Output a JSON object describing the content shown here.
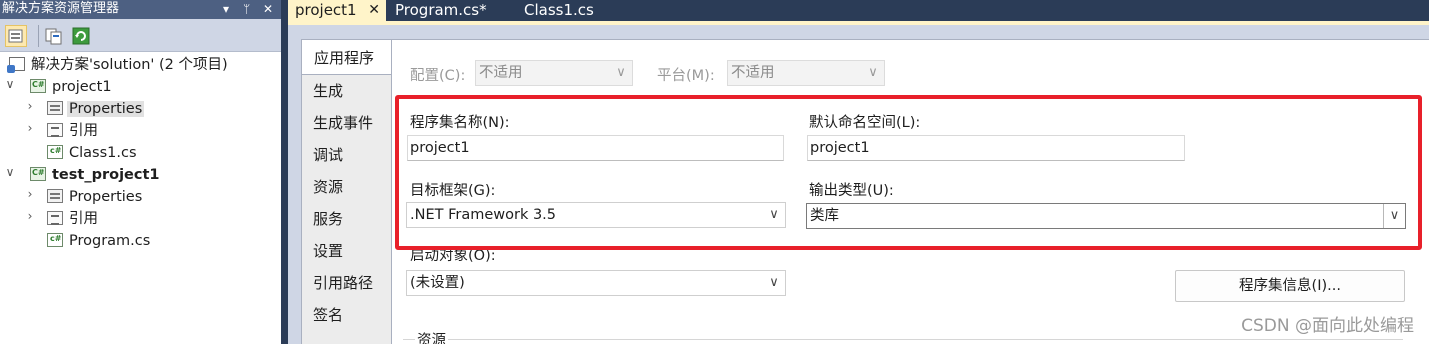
{
  "solution_explorer": {
    "title": "解决方案资源管理器",
    "pin_glyph": "▾",
    "autohide_glyph": "ᛘ",
    "close_glyph": "✕",
    "tree": [
      {
        "label": "解决方案'solution' (2 个项目)",
        "icon": "solution-icon"
      },
      {
        "label": "project1",
        "icon": "csharp-project-icon",
        "expander": "∨"
      },
      {
        "label": "Properties",
        "icon": "properties-icon",
        "expander": "›"
      },
      {
        "label": "引用",
        "icon": "references-icon",
        "expander": "›"
      },
      {
        "label": "Class1.cs",
        "icon": "csharp-file-icon"
      },
      {
        "label": "test_project1",
        "icon": "csharp-project-icon",
        "expander": "∨"
      },
      {
        "label": "Properties",
        "icon": "properties-icon",
        "expander": "›"
      },
      {
        "label": "引用",
        "icon": "references-icon",
        "expander": "›"
      },
      {
        "label": "Program.cs",
        "icon": "csharp-file-icon"
      }
    ]
  },
  "doc_tabs": [
    {
      "label": "project1",
      "close": "✕"
    },
    {
      "label": "Program.cs*"
    },
    {
      "label": "Class1.cs"
    }
  ],
  "sidebar": {
    "items": [
      "应用程序",
      "生成",
      "生成事件",
      "调试",
      "资源",
      "服务",
      "设置",
      "引用路径",
      "签名"
    ]
  },
  "form": {
    "config_label": "配置(C):",
    "config_value": "不适用",
    "platform_label": "平台(M):",
    "platform_value": "不适用",
    "assembly_name_label": "程序集名称(N):",
    "assembly_name_value": "project1",
    "default_namespace_label": "默认命名空间(L):",
    "default_namespace_value": "project1",
    "target_framework_label": "目标框架(G):",
    "target_framework_value": ".NET Framework 3.5",
    "output_type_label": "输出类型(U):",
    "output_type_value": "类库",
    "startup_object_label": "启动对象(O):",
    "startup_object_value": "(未设置)",
    "assembly_info_button": "程序集信息(I)...",
    "resources_group_label": "资源",
    "chevron": "∨"
  },
  "colors": {
    "highlight_box": "#e8202a",
    "active_tab": "#fff4c9",
    "title_bar": "#4d6082"
  },
  "watermark": "CSDN @面向此处编程"
}
